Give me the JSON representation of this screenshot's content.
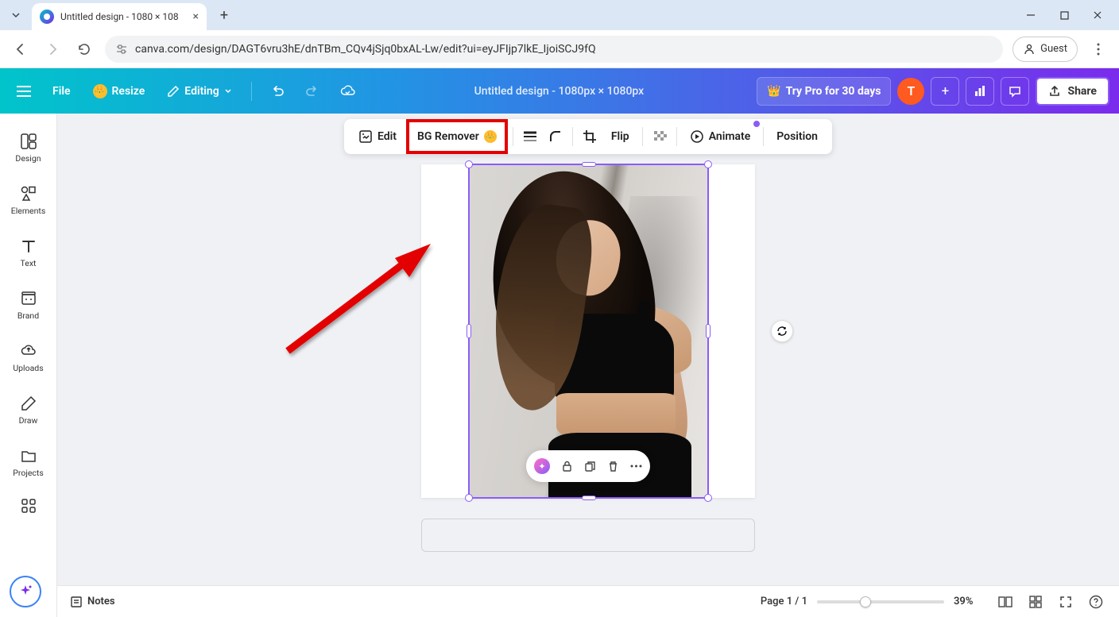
{
  "browser": {
    "tab_title": "Untitled design - 1080 × 108",
    "url": "canva.com/design/DAGT6vru3hE/dnTBm_CQv4jSjq0bxAL-Lw/edit?ui=eyJFIjp7lkE_IjoiSCJ9fQ",
    "guest_label": "Guest"
  },
  "header": {
    "file_label": "File",
    "resize_label": "Resize",
    "editing_label": "Editing",
    "doc_title": "Untitled design - 1080px × 1080px",
    "try_pro_label": "Try Pro for 30 days",
    "avatar_initial": "T",
    "share_label": "Share"
  },
  "left_rail": {
    "items": [
      {
        "label": "Design"
      },
      {
        "label": "Elements"
      },
      {
        "label": "Text"
      },
      {
        "label": "Brand"
      },
      {
        "label": "Uploads"
      },
      {
        "label": "Draw"
      },
      {
        "label": "Projects"
      }
    ]
  },
  "context_toolbar": {
    "edit_label": "Edit",
    "bg_remover_label": "BG Remover",
    "flip_label": "Flip",
    "animate_label": "Animate",
    "position_label": "Position"
  },
  "bottom_bar": {
    "notes_label": "Notes",
    "page_indicator": "Page 1 / 1",
    "zoom_pct": "39%"
  },
  "annotation": {
    "highlight_color": "#e30000"
  }
}
